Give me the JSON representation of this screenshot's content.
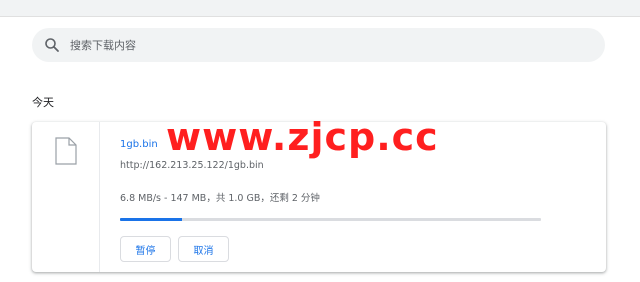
{
  "search": {
    "placeholder": "搜索下载内容",
    "icon": "search-icon"
  },
  "section": {
    "title": "今天"
  },
  "download": {
    "file_icon": "file-icon",
    "name": "1gb.bin",
    "url": "http://162.213.25.122/1gb.bin",
    "status": "6.8 MB/s - 147 MB，共 1.0 GB，还剩 2 分钟",
    "progress_fraction": 0.147,
    "pause_label": "暂停",
    "cancel_label": "取消"
  },
  "watermark": {
    "text": "www.zjcp.cc"
  },
  "colors": {
    "accent": "#1a73e8",
    "watermark": "#ff1f1f",
    "search_bg": "#f1f3f4"
  }
}
